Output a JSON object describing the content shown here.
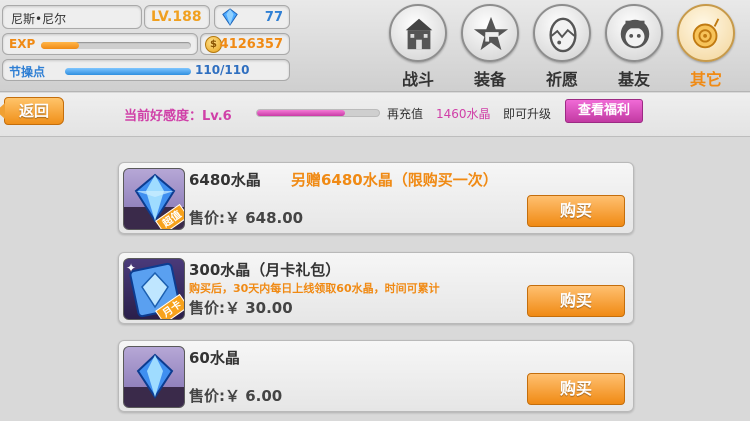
{
  "player": {
    "name": "尼斯•尼尔",
    "level": "LV.188",
    "crystals": "77",
    "exp_label": "EXP",
    "exp_progress": 0.25,
    "gold": "4126357",
    "gold_icon": "$",
    "stamina_label": "节操点",
    "stamina_value": "110/110",
    "stamina_progress": 1.0
  },
  "nav": [
    {
      "label": "战斗",
      "icon": "castle-icon",
      "active": false
    },
    {
      "label": "装备",
      "icon": "star-gun-icon",
      "active": false
    },
    {
      "label": "祈愿",
      "icon": "egg-icon",
      "active": false
    },
    {
      "label": "基友",
      "icon": "character-icon",
      "active": false
    },
    {
      "label": "其它",
      "icon": "snail-icon",
      "active": true
    }
  ],
  "affection": {
    "back_label": "返回",
    "label": "当前好感度：Lv.6",
    "progress": 0.72,
    "text_before": "再充值",
    "amount": "1460水晶",
    "text_after": "即可升级",
    "welfare_button": "查看福利"
  },
  "products": [
    {
      "title": "6480水晶",
      "bonus": "另赠6480水晶（限购买一次）",
      "desc": "",
      "price": "售价:￥ 648.00",
      "button": "购买",
      "tag": "超值"
    },
    {
      "title": "300水晶（月卡礼包）",
      "bonus": "",
      "desc": "购买后，30天内每日上线领取60水晶，时间可累计",
      "price": "售价:￥ 30.00",
      "button": "购买",
      "tag": "月卡"
    },
    {
      "title": "60水晶",
      "bonus": "",
      "desc": "",
      "price": "售价:￥ 6.00",
      "button": "购买",
      "tag": ""
    }
  ],
  "colors": {
    "accent_orange": "#f08a14",
    "accent_pink": "#d040a8",
    "accent_blue": "#2f7fd4"
  }
}
